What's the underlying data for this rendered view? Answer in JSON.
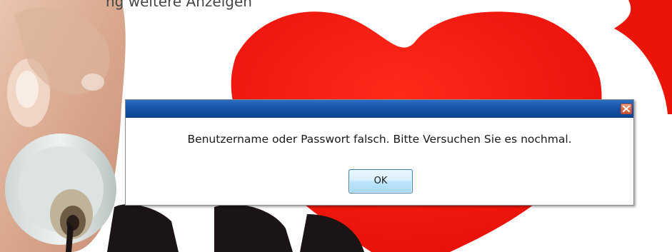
{
  "background": {
    "top_text": "ng weitere Anzeigen"
  },
  "dialog": {
    "message": "Benutzername oder Passwort falsch. Bitte Versuchen Sie es nochmal.",
    "ok_label": "OK",
    "close_icon": "close-icon",
    "titlebar_color": "#1554a8",
    "close_color": "#d9694a"
  }
}
